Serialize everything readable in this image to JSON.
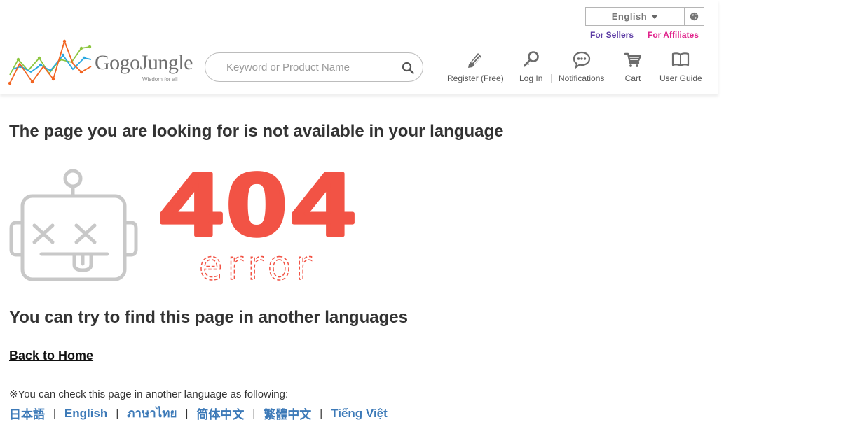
{
  "header": {
    "language_selector": {
      "current": "English",
      "caret_icon": "caret-down-icon",
      "globe_icon": "globe-icon"
    },
    "top_links": {
      "sellers": "For Sellers",
      "affiliates": "For Affiliates"
    },
    "logo": {
      "name": "GogoJungle",
      "tagline": "Wisdom for all"
    },
    "search": {
      "placeholder": "Keyword or Product Name",
      "value": "",
      "icon": "search-icon"
    },
    "nav": [
      {
        "label": "Register (Free)",
        "icon": "pencil-icon"
      },
      {
        "label": "Log In",
        "icon": "key-icon"
      },
      {
        "label": "Notifications",
        "icon": "chat-bubble-icon"
      },
      {
        "label": "Cart",
        "icon": "cart-icon"
      },
      {
        "label": "User Guide",
        "icon": "book-icon"
      }
    ]
  },
  "main": {
    "title": "The page you are looking for is not available in your language",
    "error_code": "404",
    "error_word": "error",
    "subtitle": "You can try to find this page in another languages",
    "home_link": "Back to Home",
    "note": "※You can check this page in another language as following:",
    "languages": [
      "日本語",
      "English",
      "ภาษาไทย",
      "简体中文",
      "繁體中文",
      "Tiếng Việt"
    ]
  },
  "colors": {
    "accent_red": "#f25345",
    "link_blue": "#3d7ab8",
    "sellers_purple": "#5b3aa3",
    "affiliates_pink": "#e0238b",
    "robot_gray": "#c8c8c8"
  }
}
